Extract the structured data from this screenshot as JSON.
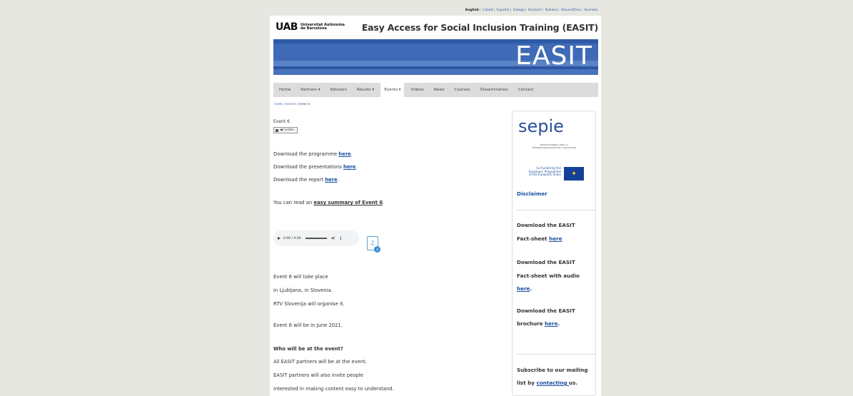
{
  "languages": {
    "current": "English",
    "others": [
      "Català",
      "Español",
      "Galego",
      "Deutsch",
      "Italiano",
      "Slovenščina",
      "Svenska"
    ]
  },
  "header": {
    "logo_mark": "UAB",
    "logo_line1": "Universitat Autònoma",
    "logo_line2": "de Barcelona",
    "site_title": "Easy Access for Social Inclusion Training (EASIT)"
  },
  "banner": {
    "logo_text": "EASIT",
    "colors": {
      "primary": "#3e6ab6",
      "dark": "#2f5aa6",
      "light": "#5a82c6"
    }
  },
  "nav": {
    "items": [
      {
        "label": "Home"
      },
      {
        "label": "Partners ▾"
      },
      {
        "label": "Advisors"
      },
      {
        "label": "Results ▾"
      },
      {
        "label": "Events ▾",
        "active": true
      },
      {
        "label": "Videos"
      },
      {
        "label": "News"
      },
      {
        "label": "Courses"
      },
      {
        "label": "Dissemination"
      },
      {
        "label": "Contact"
      }
    ]
  },
  "breadcrumb": {
    "home": "HOME",
    "events": "EVENTS",
    "current": "EVENT 6",
    "separator": "/"
  },
  "main": {
    "event_title": "Event 6",
    "listen_label": "Listen",
    "programme_prefix": "Download the programme ",
    "programme_link": "here",
    "presentations_prefix": "Download the presentations ",
    "presentations_link": "here",
    "report_prefix": "Download the report ",
    "report_link": "here",
    "summary_prefix": "You can read an ",
    "summary_link": "easy summary of Event 6",
    "audio_time": "0:00 / 0:00",
    "line1": "Event 6 will take place",
    "line2": "in Ljubljana, in Slovenia.",
    "line3": "RTV Slovenija will organise it.",
    "line4": "Event 6 will be in June 2021.",
    "heading_who": "Who will be at the event?",
    "line5": "All EASIT partners will be at the event.",
    "line6": "EASIT partners will also invite people",
    "line7": "interested in making content easy to understand."
  },
  "sidebar": {
    "sepie_logo": "sepie",
    "sepie_sub1": "SERVICIO ESPAÑOL PARA LA",
    "sepie_sub2": "INTERNACIONALIZACIÓN DE LA EDUCACIÓN",
    "cofund1": "Co-funded by the",
    "cofund2": "Erasmus+ Programme",
    "cofund3": "of the European Union",
    "disclaimer": "Disclaimer",
    "fact1_line1": "Download the EASIT",
    "fact1_line2_prefix": "Fact-sheet ",
    "fact1_link": "here",
    "fact2_line1": "Download the EASIT",
    "fact2_line2": "Fact-sheet with audio",
    "fact2_link": "here",
    "brochure_line1": "Download the EASIT",
    "brochure_prefix": "brochure ",
    "brochure_link": "here",
    "subscribe_line1": "Subscribe to our mailing",
    "subscribe_prefix": "list by ",
    "subscribe_link": "contacting ",
    "subscribe_suffix": "us."
  }
}
